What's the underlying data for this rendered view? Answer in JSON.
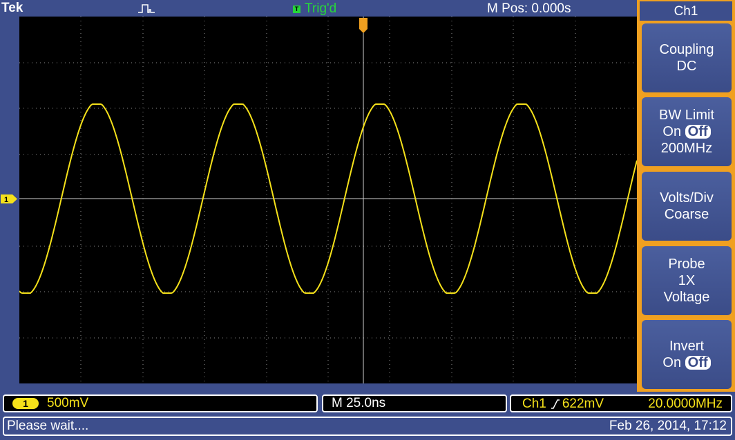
{
  "header": {
    "brand": "Tek",
    "trigger_state_icon": "T",
    "trigger_state": "Trig'd",
    "position_readout": "M Pos: 0.000s"
  },
  "channel_marker": "1",
  "side_menu": {
    "title": "Ch1",
    "buttons": [
      {
        "line1": "Coupling",
        "line2": "DC"
      },
      {
        "line1": "BW Limit",
        "on_label": "On",
        "off_label": "Off",
        "line3": "200MHz"
      },
      {
        "line1": "Volts/Div",
        "line2": "Coarse"
      },
      {
        "line1": "Probe",
        "line2": "1X",
        "line3": "Voltage"
      },
      {
        "line1": "Invert",
        "on_label": "On",
        "off_label": "Off"
      }
    ]
  },
  "status": {
    "channel_badge": "1",
    "volts_per_div": "500mV",
    "time_per_div": "M 25.0ns",
    "trigger_source": "Ch1",
    "trigger_level": "622mV",
    "frequency": "20.0000MHz",
    "message": "Please wait....",
    "datetime": "Feb 26, 2014, 17:12"
  },
  "colors": {
    "trace": "#f5e11a",
    "frame": "#3d4e8c",
    "menu_border": "#f0a020",
    "trigger_green": "#27d73a"
  }
}
